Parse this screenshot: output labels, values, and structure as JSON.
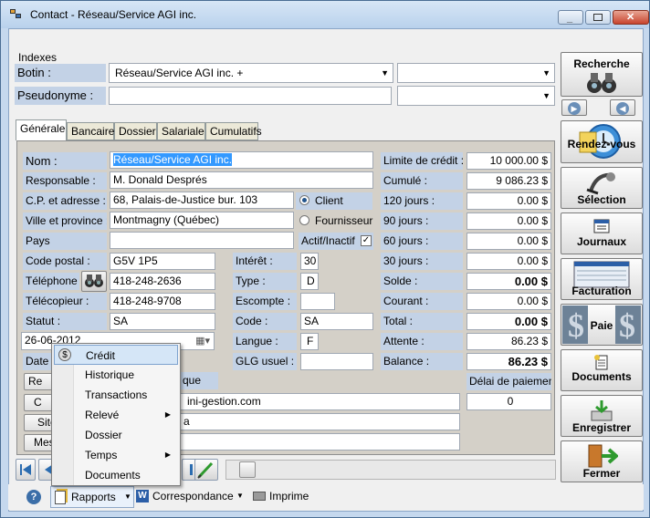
{
  "window": {
    "title": "Contact - Réseau/Service AGI inc."
  },
  "indexes": {
    "group_label": "Indexes",
    "botin_label": "Botin :",
    "botin_value": "Réseau/Service AGI inc.  +",
    "pseudonyme_label": "Pseudonyme :",
    "pseudonyme_value": ""
  },
  "tabs": [
    "Générale",
    "Bancaire",
    "Dossier",
    "Salariale",
    "Cumulatifs"
  ],
  "form": {
    "nom_label": "Nom :",
    "nom_value": "Réseau/Service AGI inc.",
    "responsable_label": "Responsable :",
    "responsable_value": "M. Donald Després",
    "cp_label": "C.P. et adresse :",
    "cp_value": "68, Palais-de-Justice bur. 103",
    "ville_label": "Ville et province :",
    "ville_value": "Montmagny (Québec)",
    "pays_label": "Pays",
    "pays_value": "",
    "codepostal_label": "Code postal :",
    "codepostal_value": "G5V 1P5",
    "telephone_label": "Téléphone :",
    "telephone_value": "418-248-2636",
    "telecopieur_label": "Télécopieur :",
    "telecopieur_value": "418-248-9708",
    "statut_label": "Statut :",
    "statut_value": "SA",
    "date_value": "26-06-2012",
    "date_label_partial": "Date (",
    "client_label": "Client",
    "fournisseur_label": "Fournisseur",
    "actif_label": "Actif/Inactif",
    "interet_label": "Intérêt :",
    "interet_value": "30",
    "type_label": "Type :",
    "type_value": "D",
    "escompte_label": "Escompte :",
    "escompte_value": "",
    "code_label": "Code :",
    "code_value": "SA",
    "langue_label": "Langue :",
    "langue_value": "F",
    "glg_label": "GLG usuel :",
    "glg_value": "",
    "hidden_label_partial": "que",
    "email_partial": "ini-gestion.com",
    "web_partial": "a",
    "btn1_partial": "Re",
    "btn2_partial": "C",
    "btn3_partial": "Site",
    "btn4_partial": "Mes"
  },
  "finance": {
    "limite_label": "Limite de crédit :",
    "limite_value": "10 000.00 $",
    "cumule_label": "Cumulé :",
    "cumule_value": "9 086.23 $",
    "j120_label": "120 jours :",
    "j120_value": "0.00 $",
    "j90_label": "90 jours :",
    "j90_value": "0.00 $",
    "j60_label": "60 jours :",
    "j60_value": "0.00 $",
    "j30_label": "30 jours :",
    "j30_value": "0.00 $",
    "solde_label": "Solde :",
    "solde_value": "0.00 $",
    "courant_label": "Courant :",
    "courant_value": "0.00 $",
    "total_label": "Total :",
    "total_value": "0.00 $",
    "attente_label": "Attente :",
    "attente_value": "86.23 $",
    "balance_label": "Balance :",
    "balance_value": "86.23 $",
    "delai_label": "Délai de paiement",
    "delai_value": "0"
  },
  "sidebar": {
    "recherche": "Recherche",
    "rendezvous": "Rendez-vous",
    "selection": "Sélection",
    "journaux": "Journaux",
    "facturation": "Facturation",
    "paie": "Paie",
    "documents": "Documents",
    "enregistrer": "Enregistrer",
    "fermer": "Fermer"
  },
  "context_menu": [
    {
      "label": "Crédit",
      "submenu": false
    },
    {
      "label": "Historique",
      "submenu": false
    },
    {
      "label": "Transactions",
      "submenu": false
    },
    {
      "label": "Relevé",
      "submenu": true
    },
    {
      "label": "Dossier",
      "submenu": false
    },
    {
      "label": "Temps",
      "submenu": true
    },
    {
      "label": "Documents",
      "submenu": false
    }
  ],
  "bottombar": {
    "rapports": "Rapports",
    "correspondance": "Correspondance",
    "imprime": "Imprime"
  },
  "icons": {
    "app": "app-window-icon",
    "binoculars": "binoculars-icon",
    "calendar": "calendar-icon",
    "help": "help-icon"
  }
}
